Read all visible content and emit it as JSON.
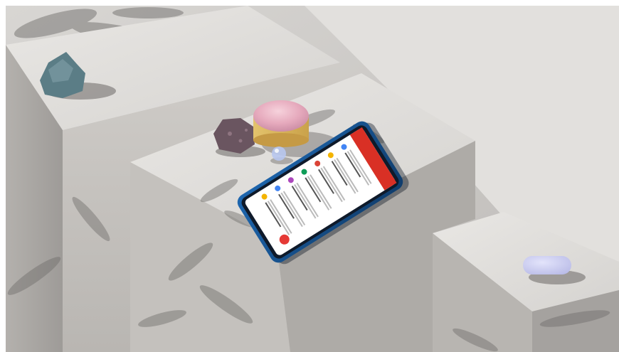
{
  "scene": {
    "description_tag": "product-photo",
    "palette": {
      "stone_light": "#e4e2df",
      "stone_mid": "#c9c6c2",
      "stone_dark": "#a9a6a3",
      "shadow": "#6f6c6a",
      "phone_body": "#1c4f8a",
      "phone_bezel": "#0f1a2a",
      "app_header": "#d93025",
      "app_bg": "#ffffff",
      "fab": "#e53935",
      "pink_object": "#e8b3c2",
      "gold_tint": "#d9b25a",
      "lavender_object": "#c9cbef",
      "rock_teal": "#5b7d86",
      "rock_purple": "#6a5560"
    },
    "phone": {
      "app_icon_colors": [
        "#4285f4",
        "#f4b400",
        "#db4437",
        "#0f9d58",
        "#ab47bc",
        "#4285f4",
        "#f4b400"
      ]
    }
  }
}
